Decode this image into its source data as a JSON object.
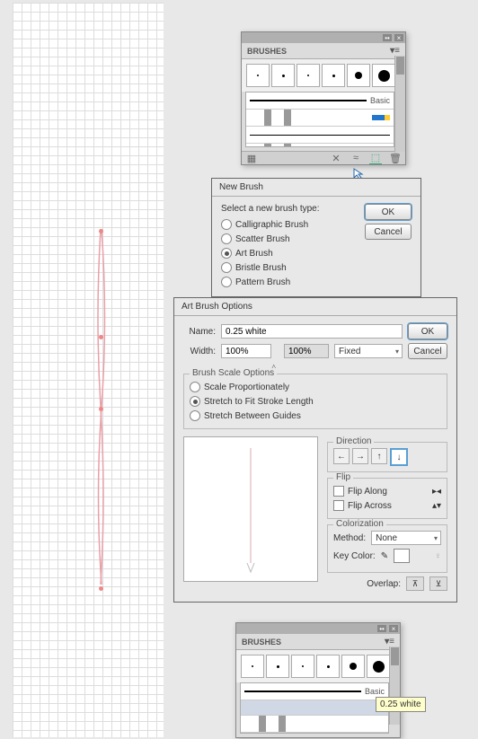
{
  "brushes_panel": {
    "title": "BRUSHES",
    "basic_label": "Basic"
  },
  "new_brush": {
    "title": "New Brush",
    "instruction": "Select a new brush type:",
    "options": {
      "calligraphic": "Calligraphic Brush",
      "scatter": "Scatter Brush",
      "art": "Art Brush",
      "bristle": "Bristle Brush",
      "pattern": "Pattern Brush"
    },
    "ok": "OK",
    "cancel": "Cancel"
  },
  "art_brush": {
    "title": "Art Brush Options",
    "name_label": "Name:",
    "name_value": "0.25 white",
    "width_label": "Width:",
    "width_from": "100%",
    "width_to": "100%",
    "width_mode": "Fixed",
    "scale_title": "Brush Scale Options",
    "scale_prop": "Scale Proportionately",
    "scale_stretch": "Stretch to Fit Stroke Length",
    "scale_between": "Stretch Between Guides",
    "direction": "Direction",
    "flip": "Flip",
    "flip_along": "Flip Along",
    "flip_across": "Flip Across",
    "colorization": "Colorization",
    "method_label": "Method:",
    "method_value": "None",
    "keycolor_label": "Key Color:",
    "overlap_label": "Overlap:",
    "ok": "OK",
    "cancel": "Cancel"
  },
  "tooltip": "0.25 white"
}
